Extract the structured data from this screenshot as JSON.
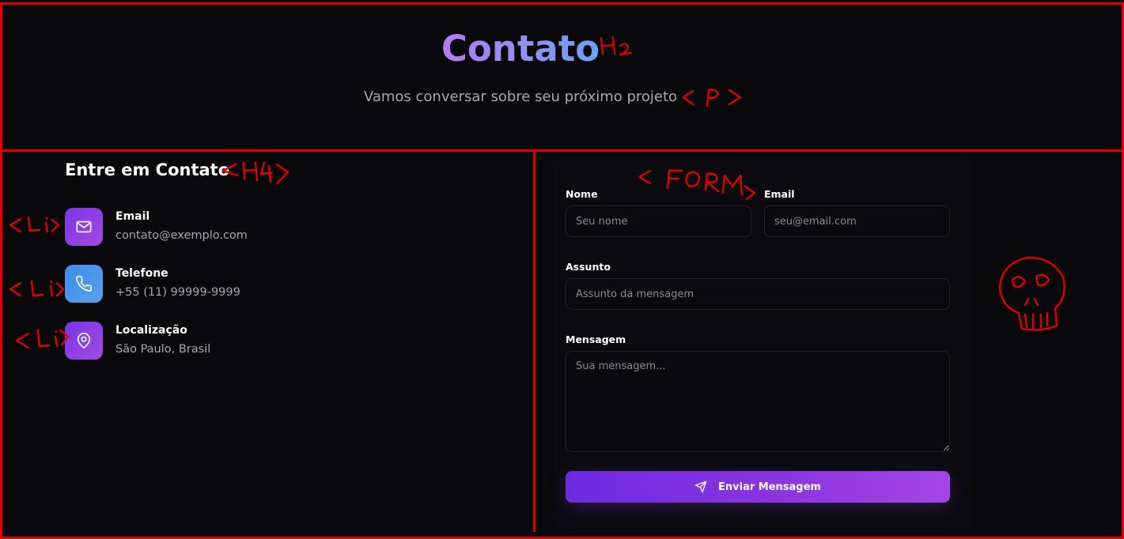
{
  "header": {
    "title": "Contato",
    "subtitle": "Vamos conversar sobre seu próximo projeto"
  },
  "contact_info": {
    "title": "Entre em Contato",
    "items": [
      {
        "label": "Email",
        "value": "contato@exemplo.com",
        "icon": "mail-icon"
      },
      {
        "label": "Telefone",
        "value": "+55 (11) 99999-9999",
        "icon": "phone-icon"
      },
      {
        "label": "Localização",
        "value": "São Paulo, Brasil",
        "icon": "map-pin-icon"
      }
    ]
  },
  "form": {
    "name_label": "Nome",
    "name_placeholder": "Seu nome",
    "email_label": "Email",
    "email_placeholder": "seu@email.com",
    "subject_label": "Assunto",
    "subject_placeholder": "Assunto da mensagem",
    "message_label": "Mensagem",
    "message_placeholder": "Sua mensagem...",
    "submit_label": "Enviar Mensagem",
    "submit_icon": "send-icon"
  },
  "colors": {
    "background": "#09090c",
    "accent_purple": "#7a35e8",
    "accent_blue": "#3a8ee8",
    "annotation_red": "#e00000"
  }
}
